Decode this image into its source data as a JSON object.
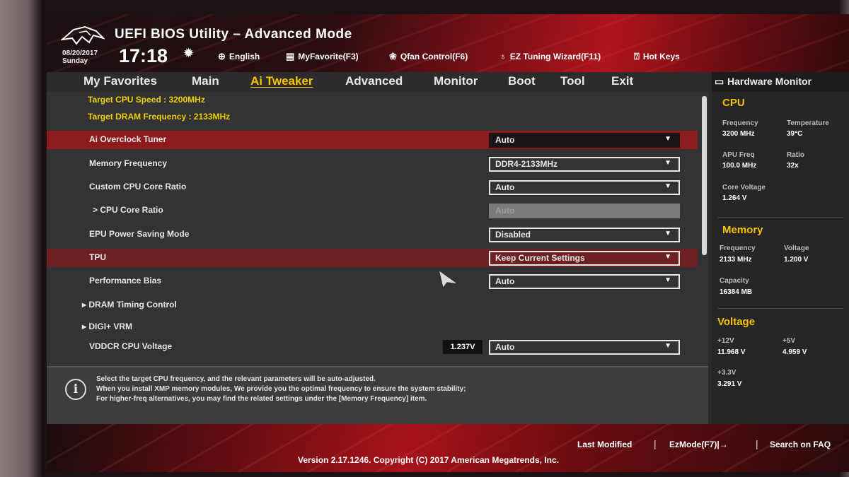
{
  "header": {
    "title": "UEFI BIOS Utility – Advanced Mode",
    "date": "08/20/2017",
    "day": "Sunday",
    "time": "17:18",
    "links": {
      "language": "English",
      "favorite": "MyFavorite(F3)",
      "qfan": "Qfan Control(F6)",
      "ez_tuning": "EZ Tuning Wizard(F11)",
      "hotkeys": "Hot Keys"
    }
  },
  "tabs": [
    "My Favorites",
    "Main",
    "Ai Tweaker",
    "Advanced",
    "Monitor",
    "Boot",
    "Tool",
    "Exit"
  ],
  "active_tab": "Ai Tweaker",
  "main": {
    "target_cpu": "Target CPU Speed : 3200MHz",
    "target_dram": "Target DRAM Frequency : 2133MHz",
    "rows": [
      {
        "label": "Ai Overclock Tuner",
        "value": "Auto"
      },
      {
        "label": "Memory Frequency",
        "value": "DDR4-2133MHz"
      },
      {
        "label": "Custom CPU Core Ratio",
        "value": "Auto"
      },
      {
        "label": "> CPU Core Ratio",
        "value": "Auto"
      },
      {
        "label": "EPU Power Saving Mode",
        "value": "Disabled"
      },
      {
        "label": "TPU",
        "value": "Keep Current Settings"
      },
      {
        "label": "Performance Bias",
        "value": "Auto"
      },
      {
        "label": "DRAM Timing Control"
      },
      {
        "label": "DIGI+ VRM"
      },
      {
        "label": "VDDCR CPU Voltage",
        "value": "Auto",
        "reading": "1.237V"
      }
    ]
  },
  "info": {
    "line1": "Select the target CPU frequency, and the relevant parameters will be auto-adjusted.",
    "line2": "When you install XMP memory modules, We provide you the optimal frequency to ensure the system stability;",
    "line3": "For higher-freq alternatives, you may find the related settings under the [Memory Frequency] item."
  },
  "hw": {
    "title": "Hardware Monitor",
    "cpu": {
      "title": "CPU",
      "frequency_label": "Frequency",
      "frequency": "3200 MHz",
      "temperature_label": "Temperature",
      "temperature": "39°C",
      "apu_label": "APU Freq",
      "apu": "100.0 MHz",
      "ratio_label": "Ratio",
      "ratio": "32x",
      "core_voltage_label": "Core Voltage",
      "core_voltage": "1.264 V"
    },
    "memory": {
      "title": "Memory",
      "frequency_label": "Frequency",
      "frequency": "2133 MHz",
      "voltage_label": "Voltage",
      "voltage": "1.200 V",
      "capacity_label": "Capacity",
      "capacity": "16384 MB"
    },
    "voltage": {
      "title": "Voltage",
      "v12_label": "+12V",
      "v12": "11.968 V",
      "v5_label": "+5V",
      "v5": "4.959 V",
      "v33_label": "+3.3V",
      "v33": "3.291 V"
    }
  },
  "footer": {
    "last_modified": "Last Modified",
    "ezmode": "EzMode(F7)|→",
    "search_faq": "Search on FAQ",
    "version": "Version 2.17.1246. Copyright (C) 2017 American Megatrends, Inc."
  },
  "colors": {
    "accent": "#f5c400",
    "selected_row": "#8e1c1e",
    "brand_red": "#b0141c"
  }
}
